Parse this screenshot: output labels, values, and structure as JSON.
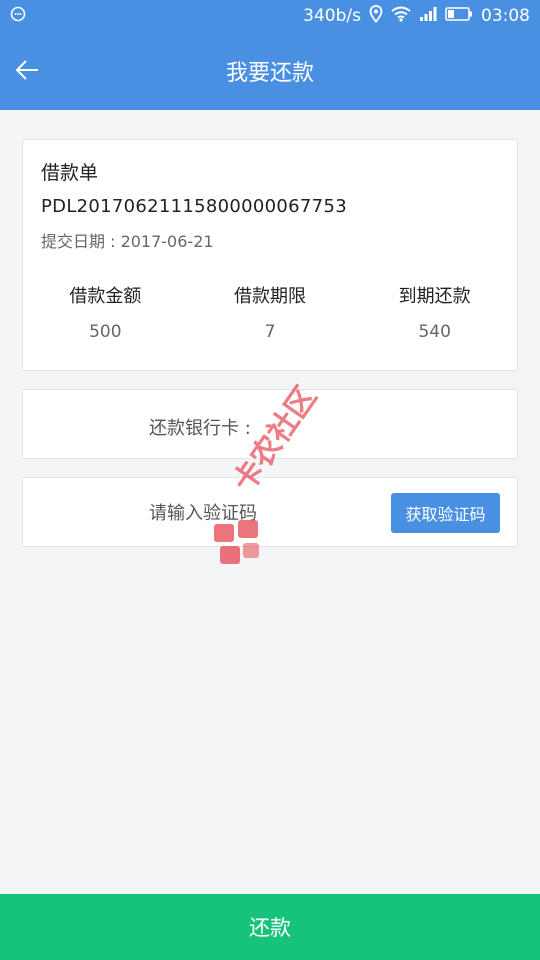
{
  "status_bar": {
    "notification_icon": "messenger-icon",
    "network_speed": "340b/s",
    "location_icon": "location-pin-icon",
    "wifi_icon": "wifi-icon",
    "signal_icon": "signal-bars-icon",
    "battery_icon": "battery-icon",
    "time": "03:08"
  },
  "app_bar": {
    "back_icon": "arrow-left-icon",
    "title": "我要还款"
  },
  "loan_card": {
    "label": "借款单",
    "loan_number": "PDL20170621115800000067753",
    "submit_date": "提交日期 : 2017-06-21",
    "stats": [
      {
        "header": "借款金额",
        "value": "500"
      },
      {
        "header": "借款期限",
        "value": "7"
      },
      {
        "header": "到期还款",
        "value": "540"
      }
    ]
  },
  "bank_card": {
    "label": "还款银行卡 :"
  },
  "verification": {
    "placeholder": "请输入验证码",
    "value": "",
    "button_label": "获取验证码"
  },
  "watermark": {
    "text": "卡农社区",
    "logo_icon": "kanong-logo-icon"
  },
  "footer": {
    "repay_label": "还款"
  },
  "colors": {
    "primary": "#4a90e2",
    "repay_green": "#17c37b",
    "background": "#f4f5f7"
  }
}
